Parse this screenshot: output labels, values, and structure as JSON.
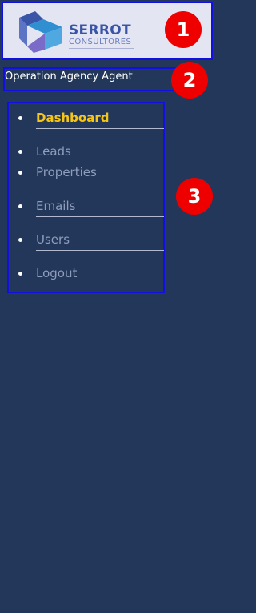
{
  "brand": {
    "name": "SERROT",
    "subtitle": "CONSULTORES",
    "logo_icon": "serrot-logo-icon"
  },
  "role": {
    "label": "Operation Agency Agent"
  },
  "nav": {
    "items": [
      {
        "label": "Dashboard",
        "active": true
      },
      {
        "label": "Leads"
      },
      {
        "label": "Properties"
      },
      {
        "label": "Emails"
      },
      {
        "label": "Users"
      },
      {
        "label": "Logout"
      }
    ]
  },
  "badges": [
    "1",
    "2",
    "3"
  ],
  "colors": {
    "sidebar_bg": "#22375a",
    "active": "#f5c518",
    "badge": "#ee0000",
    "outline": "#1010e0"
  }
}
